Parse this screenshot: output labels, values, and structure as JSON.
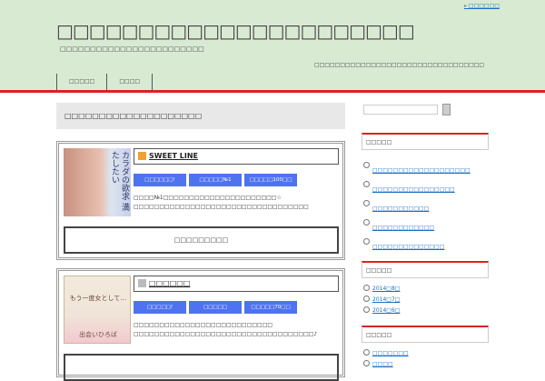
{
  "header": {
    "top_link": "□□□□□□",
    "title": "□□□□□□□□□□□□□□□□□□□□□□",
    "subtitle": "□□□□□□□□□□□□□□□□□□□□□□□□",
    "description": "□□□□□□□□□□□□□□□□□□□□□□□□□□□□□□□□□",
    "nav": [
      "□□□□□",
      "□□□□"
    ]
  },
  "main": {
    "heading": "□□□□□□□□□□□□□□□□□□□□",
    "cards": [
      {
        "title": "SWEET LINE",
        "tags": [
          "□□□□□□!",
          "□□□□□№1",
          "□□□□□100□□"
        ],
        "lines": [
          "□□□□№1□□□□□□□□□□□□□□□□□□□□□□☆",
          "□□□□□□□□□□□□□□□□□□□□□□□□□□□□□□□□□□"
        ],
        "button": "□□□□□□□□□",
        "image_text": "カラダの欲求 満たしたい"
      },
      {
        "title": "□□□□□□",
        "tags": [
          "□□□□□!",
          "□□□□□",
          "□□□□□70□□"
        ],
        "lines": [
          "□□□□□□□□□□□□□□□□□□□□□□□□□□□",
          "□□□□□□□□□□□□□□□□□□□□□□□□□□□□□□□□□□□♪"
        ],
        "button": "",
        "image_text": "もう一度女として… 出会いひろば"
      }
    ]
  },
  "sidebar": {
    "widgets": [
      {
        "title": "□□□□□",
        "items": [
          "□□□□□□□□□□□□□□□□□□□",
          "□□□□□□□□□□□□□□□□",
          "□□□□□□□□□□□",
          "□□□□□□□□□□□□",
          "□□□□□□□□□□□□□□"
        ]
      },
      {
        "title": "□□□□□",
        "items": [
          "2014□8□",
          "2014□7□",
          "2014□6□"
        ]
      },
      {
        "title": "□□□□□",
        "items": [
          "□□□□□□□",
          "□□□□"
        ]
      }
    ]
  }
}
